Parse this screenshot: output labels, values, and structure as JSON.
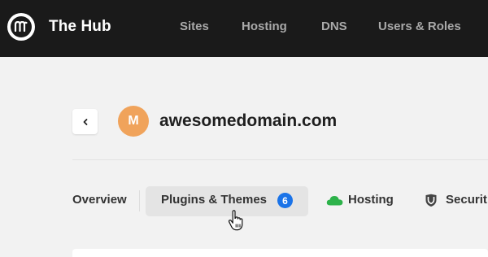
{
  "app": {
    "brand": "The Hub",
    "logo_icon": "hub-logo-icon"
  },
  "nav": {
    "items": [
      {
        "label": "Sites"
      },
      {
        "label": "Hosting"
      },
      {
        "label": "DNS"
      },
      {
        "label": "Users & Roles"
      }
    ]
  },
  "site": {
    "back_icon": "chevron-left-icon",
    "avatar_letter": "M",
    "avatar_color": "#f0a35b",
    "domain": "awesomedomain.com"
  },
  "tabs": [
    {
      "label": "Overview",
      "active": false
    },
    {
      "label": "Plugins & Themes",
      "active": true,
      "badge": "6",
      "badge_color": "#1a73e8"
    },
    {
      "label": "Hosting",
      "active": false,
      "icon": "cloud-icon",
      "icon_color": "#2db24a"
    },
    {
      "label": "Securit",
      "active": false,
      "icon": "shield-icon"
    }
  ],
  "cursor": "hand-pointer-icon"
}
